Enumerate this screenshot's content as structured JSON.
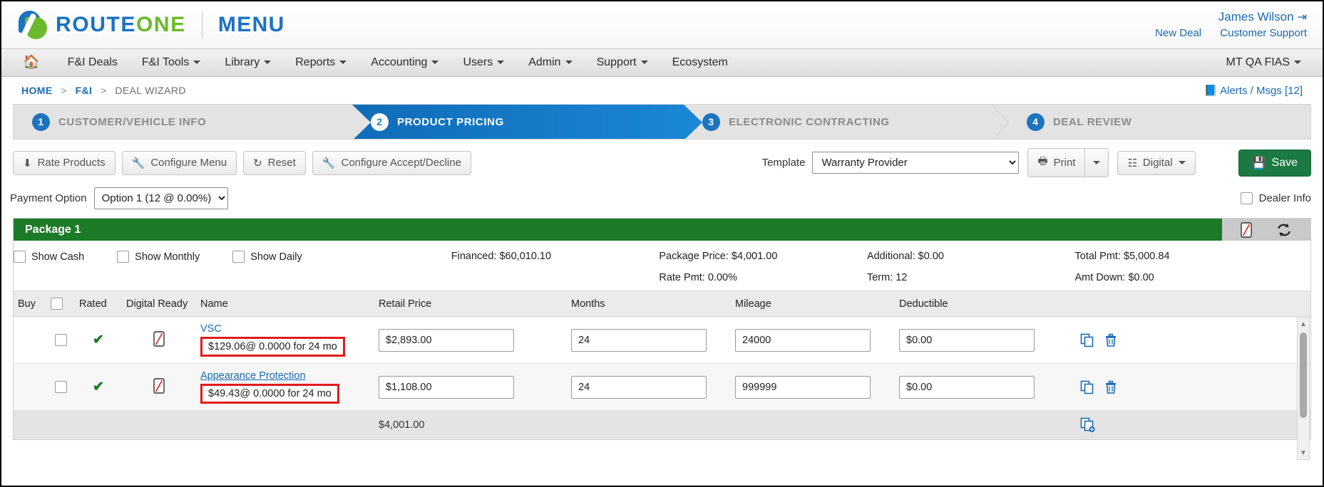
{
  "header": {
    "brand_route": "ROUTE",
    "brand_one": "ONE",
    "menu_word": "MENU",
    "user_name": "James Wilson",
    "logout_icon": "sign-out-icon",
    "new_deal": "New Deal",
    "customer_support": "Customer Support"
  },
  "nav": {
    "home_icon": "home-icon",
    "items": [
      {
        "label": "F&I Deals",
        "caret": false
      },
      {
        "label": "F&I Tools",
        "caret": true
      },
      {
        "label": "Library",
        "caret": true
      },
      {
        "label": "Reports",
        "caret": true
      },
      {
        "label": "Accounting",
        "caret": true
      },
      {
        "label": "Users",
        "caret": true
      },
      {
        "label": "Admin",
        "caret": true
      },
      {
        "label": "Support",
        "caret": true
      },
      {
        "label": "Ecosystem",
        "caret": false
      }
    ],
    "org": "MT QA FIAS"
  },
  "breadcrumb": {
    "home": "HOME",
    "fi": "F&I",
    "current": "DEAL WIZARD",
    "sep": ">",
    "alerts": "Alerts / Msgs [12]",
    "alerts_icon": "book-icon"
  },
  "wizard": {
    "steps": [
      {
        "num": "1",
        "label": "CUSTOMER/VEHICLE INFO"
      },
      {
        "num": "2",
        "label": "PRODUCT PRICING"
      },
      {
        "num": "3",
        "label": "ELECTRONIC CONTRACTING"
      },
      {
        "num": "4",
        "label": "DEAL REVIEW"
      }
    ]
  },
  "toolbar": {
    "rate_products": "Rate Products",
    "configure_menu": "Configure Menu",
    "reset": "Reset",
    "configure_accept_decline": "Configure Accept/Decline",
    "template_label": "Template",
    "template_value": "Warranty Provider",
    "template_options": [
      "Warranty Provider"
    ],
    "print": "Print",
    "digital": "Digital",
    "save": "Save",
    "icons": {
      "rate_products": "download-icon",
      "configure_menu": "wrench-icon",
      "reset": "refresh-icon",
      "configure_accept_decline": "wrench-icon",
      "print": "printer-icon",
      "digital": "qr-code-icon",
      "save": "floppy-disk-icon"
    }
  },
  "payment": {
    "label": "Payment Option",
    "value": "Option 1 (12 @ 0.00%)",
    "options": [
      "Option 1 (12 @ 0.00%)"
    ],
    "dealer_info": "Dealer Info"
  },
  "package": {
    "title": "Package 1",
    "header_icons": [
      "mobile-disabled-icon",
      "refresh-icon"
    ],
    "show_cash": "Show Cash",
    "show_monthly": "Show Monthly",
    "show_daily": "Show Daily",
    "summary": {
      "financed": "Financed: $60,010.10",
      "package_price": "Package Price: $4,001.00",
      "rate_pmt": "Rate Pmt: 0.00%",
      "additional": "Additional: $0.00",
      "term": "Term: 12",
      "total_pmt": "Total Pmt: $5,000.84",
      "amt_down": "Amt Down: $0.00"
    }
  },
  "table": {
    "headers": {
      "buy": "Buy",
      "rated": "Rated",
      "digital_ready": "Digital Ready",
      "name": "Name",
      "retail_price": "Retail Price",
      "months": "Months",
      "mileage": "Mileage",
      "deductible": "Deductible"
    },
    "rows": [
      {
        "rated_icon": "check-icon",
        "digital_ready_icon": "mobile-disabled-icon",
        "name": "VSC",
        "payment": "$129.06@ 0.0000 for 24 mo",
        "retail_price": "$2,893.00",
        "months": "24",
        "mileage": "24000",
        "deductible": "$0.00",
        "copy_icon": "copy-icon",
        "delete_icon": "trash-icon"
      },
      {
        "rated_icon": "check-icon",
        "digital_ready_icon": "mobile-disabled-icon",
        "name": "Appearance Protection",
        "payment": "$49.43@ 0.0000 for 24 mo",
        "retail_price": "$1,108.00",
        "months": "24",
        "mileage": "999999",
        "deductible": "$0.00",
        "copy_icon": "copy-icon",
        "delete_icon": "trash-icon"
      }
    ],
    "total": "$4,001.00",
    "add_icon": "copy-add-icon"
  },
  "colors": {
    "brand_blue": "#1a72c4",
    "brand_green": "#6aba2c",
    "package_green": "#1d7a28",
    "save_green": "#1b7a43",
    "active_step_blue": "#1a86d6",
    "highlight_red": "#e01b1b",
    "link_blue": "#1a6bb5"
  }
}
